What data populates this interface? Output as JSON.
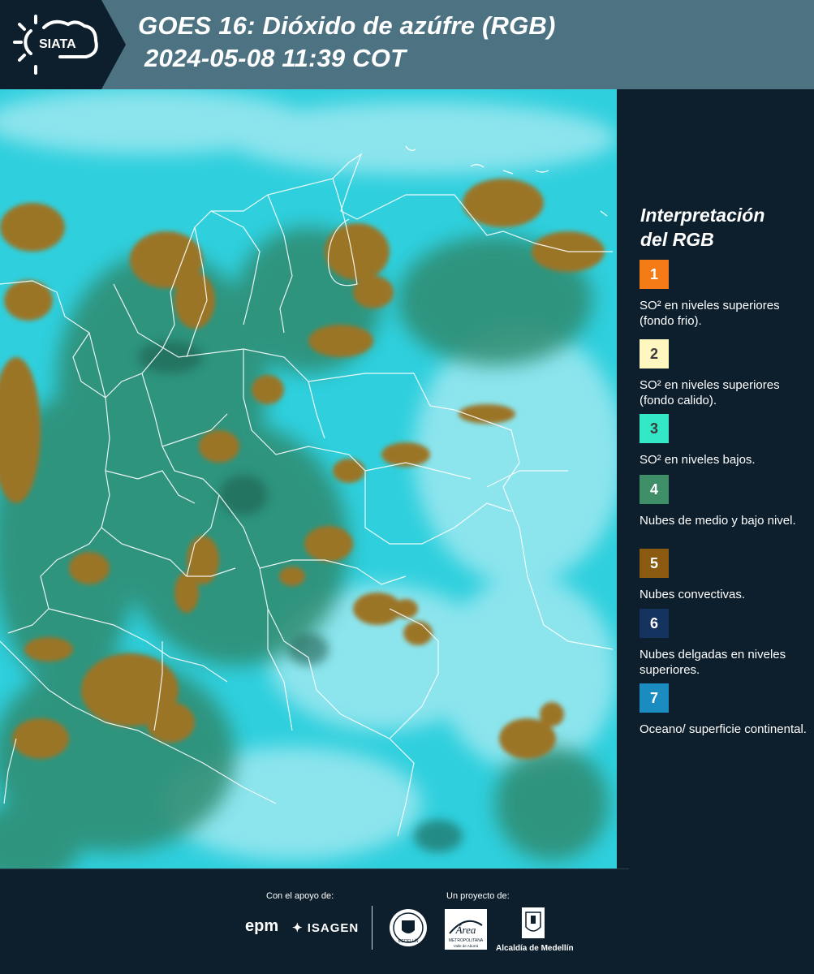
{
  "header": {
    "logo_text": "SIATA",
    "title_line1": "GOES 16: Dióxido de azúfre (RGB)",
    "title_line2": "2024-05-08 11:39 COT"
  },
  "legend": {
    "title_line1": "Interpretación",
    "title_line2": "del RGB",
    "items": [
      {
        "number": "1",
        "color": "#f47b16",
        "text_color": "#ffffff",
        "description": "SO² en niveles superiores (fondo frio)."
      },
      {
        "number": "2",
        "color": "#fef7c0",
        "text_color": "#3a3a3a",
        "description": "SO² en niveles superiores (fondo calido)."
      },
      {
        "number": "3",
        "color": "#33e8c6",
        "text_color": "#3a3a3a",
        "description": "SO² en niveles bajos."
      },
      {
        "number": "4",
        "color": "#3e8e68",
        "text_color": "#ffffff",
        "description": "Nubes de medio y bajo nivel."
      },
      {
        "number": "5",
        "color": "#8a5a10",
        "text_color": "#ffffff",
        "description": "Nubes convectivas."
      },
      {
        "number": "6",
        "color": "#14335e",
        "text_color": "#ffffff",
        "description": "Nubes delgadas en niveles superiores."
      },
      {
        "number": "7",
        "color": "#1b8cc0",
        "text_color": "#ffffff",
        "description": "Oceano/ superficie continental."
      }
    ]
  },
  "footer": {
    "support_label": "Con el apoyo de:",
    "project_label": "Un proyecto de:",
    "sponsor_1": "epm",
    "sponsor_2": "ISAGEN",
    "area_logo_text": "Área",
    "area_sub_1": "METROPOLITANA",
    "area_sub_2": "Valle de Aburrá",
    "alcaldia_label": "Alcaldía de Medellín",
    "seal_text": "MEDELLÍN"
  },
  "colors": {
    "background": "#0d1f2c",
    "header": "#4d7382",
    "map_cyan": "#2fd0de",
    "cloud_convective": "#9a7428",
    "cloud_low": "#2f8a70"
  }
}
